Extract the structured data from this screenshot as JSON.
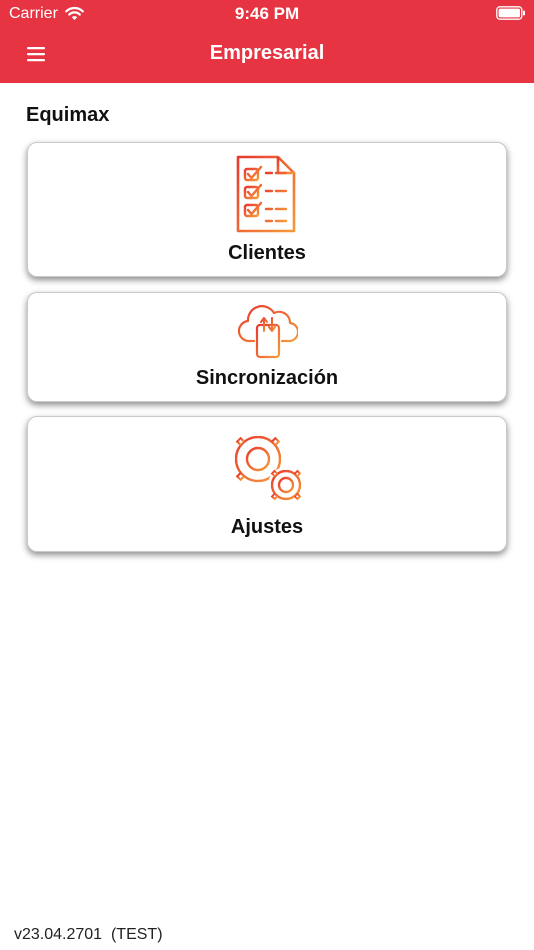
{
  "status_bar": {
    "carrier": "Carrier",
    "time": "9:46 PM"
  },
  "header": {
    "title": "Empresarial"
  },
  "section": {
    "title": "Equimax"
  },
  "cards": [
    {
      "label": "Clientes",
      "icon": "checklist-document-icon"
    },
    {
      "label": "Sincronización",
      "icon": "cloud-sync-device-icon"
    },
    {
      "label": "Ajustes",
      "icon": "gears-icon"
    }
  ],
  "footer": {
    "version": "v23.04.2701  (TEST)"
  },
  "colors": {
    "header": "#e63442",
    "icon_gradient_start": "#e8392f",
    "icon_gradient_end": "#f59a3a"
  }
}
